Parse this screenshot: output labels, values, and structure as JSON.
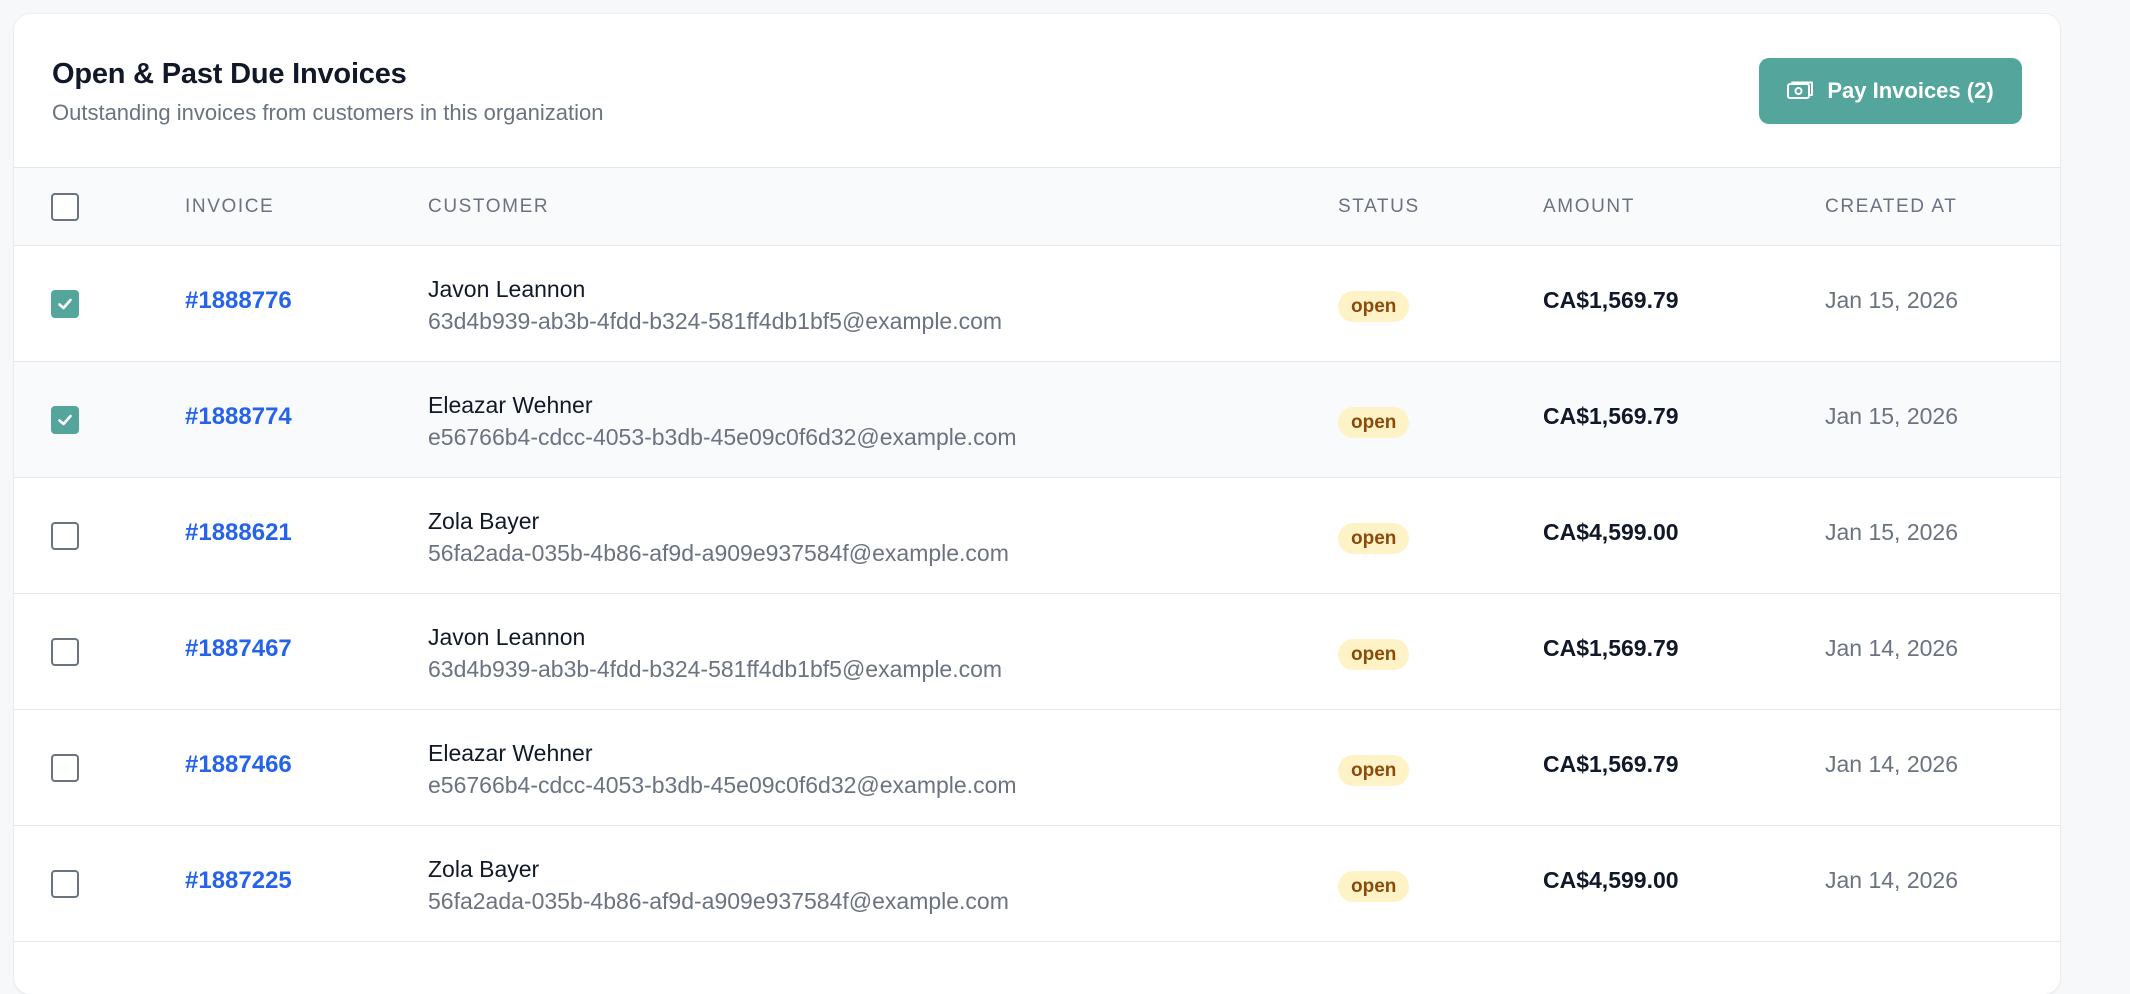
{
  "header": {
    "title": "Open & Past Due Invoices",
    "subtitle": "Outstanding invoices from customers in this organization",
    "pay_button_label": "Pay Invoices (2)",
    "pay_button_icon": "banknote-icon"
  },
  "table": {
    "columns": [
      "INVOICE",
      "CUSTOMER",
      "STATUS",
      "AMOUNT",
      "CREATED AT"
    ],
    "select_all_checked": false,
    "rows": [
      {
        "checked": true,
        "invoice": "#1888776",
        "customer_name": "Javon Leannon",
        "customer_email": "63d4b939-ab3b-4fdd-b324-581ff4db1bf5@example.com",
        "status": "open",
        "amount": "CA$1,569.79",
        "created_at": "Jan 15, 2026"
      },
      {
        "checked": true,
        "invoice": "#1888774",
        "customer_name": "Eleazar Wehner",
        "customer_email": "e56766b4-cdcc-4053-b3db-45e09c0f6d32@example.com",
        "status": "open",
        "amount": "CA$1,569.79",
        "created_at": "Jan 15, 2026"
      },
      {
        "checked": false,
        "invoice": "#1888621",
        "customer_name": "Zola Bayer",
        "customer_email": "56fa2ada-035b-4b86-af9d-a909e937584f@example.com",
        "status": "open",
        "amount": "CA$4,599.00",
        "created_at": "Jan 15, 2026"
      },
      {
        "checked": false,
        "invoice": "#1887467",
        "customer_name": "Javon Leannon",
        "customer_email": "63d4b939-ab3b-4fdd-b324-581ff4db1bf5@example.com",
        "status": "open",
        "amount": "CA$1,569.79",
        "created_at": "Jan 14, 2026"
      },
      {
        "checked": false,
        "invoice": "#1887466",
        "customer_name": "Eleazar Wehner",
        "customer_email": "e56766b4-cdcc-4053-b3db-45e09c0f6d32@example.com",
        "status": "open",
        "amount": "CA$1,569.79",
        "created_at": "Jan 14, 2026"
      },
      {
        "checked": false,
        "invoice": "#1887225",
        "customer_name": "Zola Bayer",
        "customer_email": "56fa2ada-035b-4b86-af9d-a909e937584f@example.com",
        "status": "open",
        "amount": "CA$4,599.00",
        "created_at": "Jan 14, 2026"
      }
    ]
  },
  "colors": {
    "accent": "#54a69c",
    "link": "#2563eb",
    "badge_bg": "#fef3c7",
    "badge_text": "#8a4b0b"
  }
}
